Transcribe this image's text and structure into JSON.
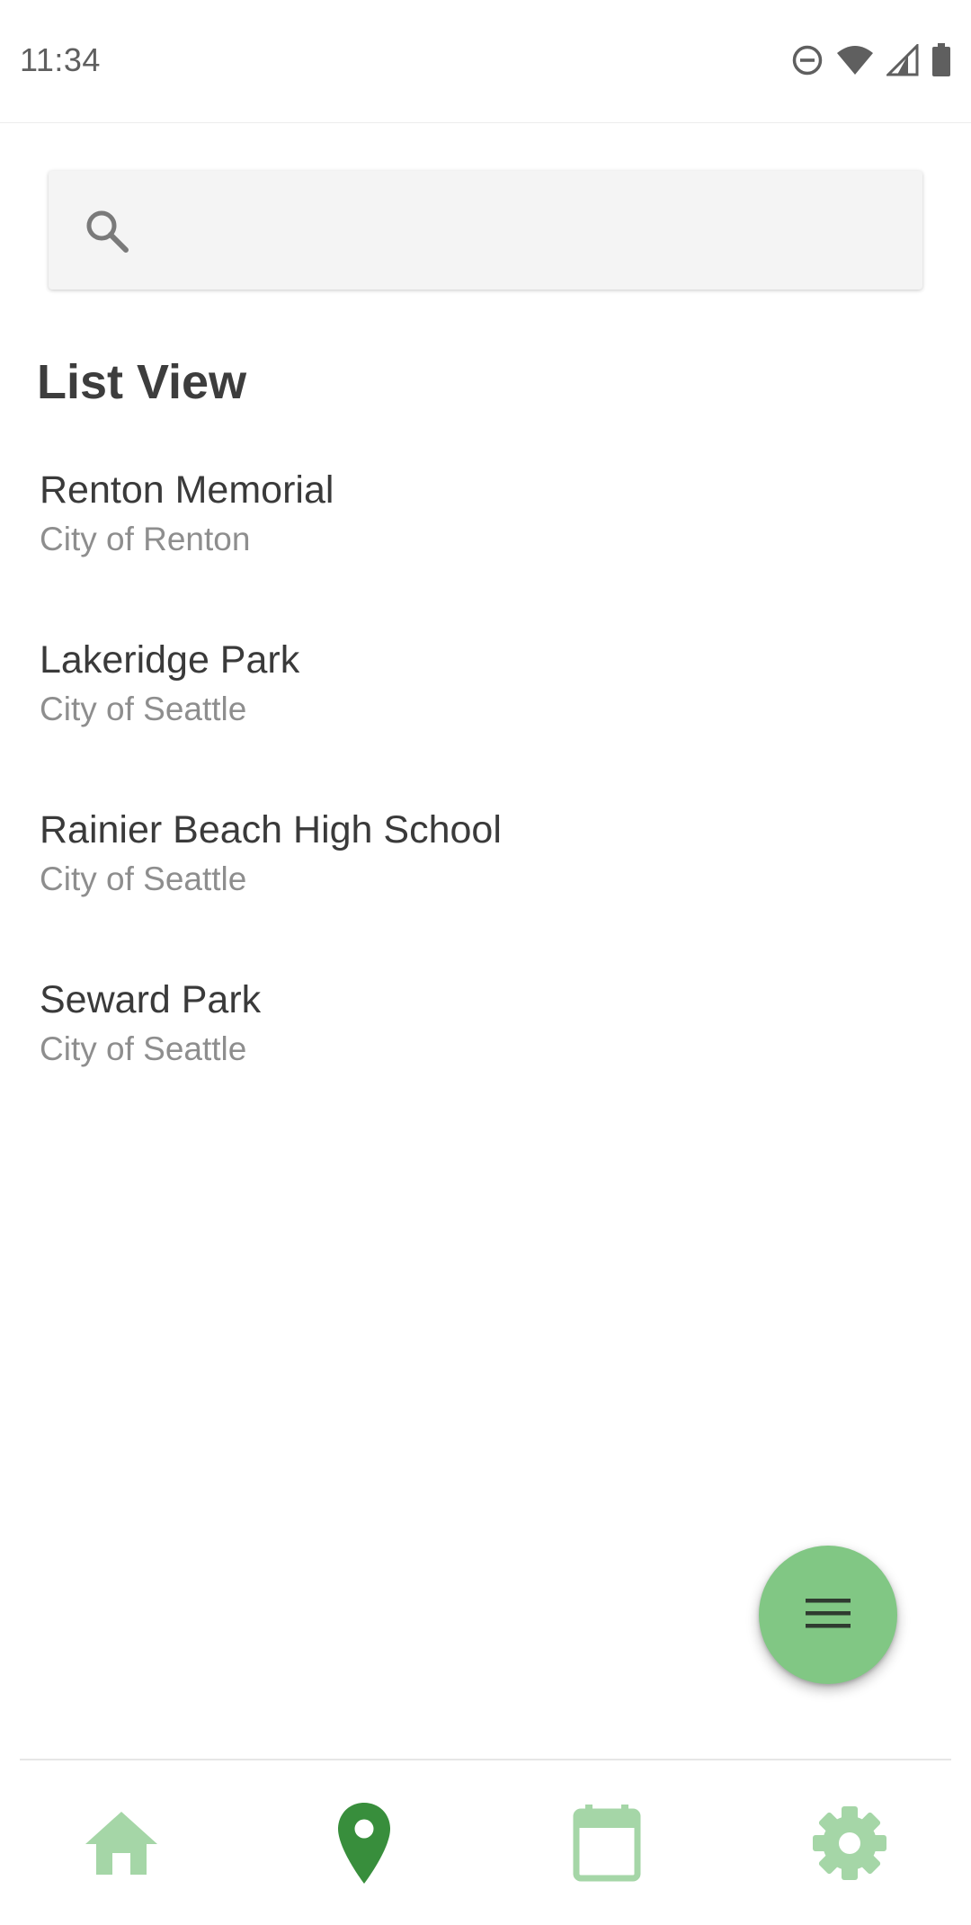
{
  "status_bar": {
    "time": "11:34",
    "icons": [
      "do-not-disturb-icon",
      "wifi-icon",
      "signal-icon",
      "battery-icon"
    ]
  },
  "search": {
    "placeholder": "",
    "value": "",
    "icon": "search-icon"
  },
  "main": {
    "title": "List View",
    "items": [
      {
        "name": "Renton Memorial",
        "subtitle": "City of Renton"
      },
      {
        "name": "Lakeridge Park",
        "subtitle": "City of Seattle"
      },
      {
        "name": "Rainier Beach High School",
        "subtitle": "City of Seattle"
      },
      {
        "name": "Seward Park",
        "subtitle": "City of Seattle"
      }
    ]
  },
  "fab": {
    "icon": "menu-icon",
    "color": "#81c784"
  },
  "bottom_nav": {
    "items": [
      {
        "icon": "home-icon",
        "active": false
      },
      {
        "icon": "map-pin-icon",
        "active": true
      },
      {
        "icon": "calendar-icon",
        "active": false
      },
      {
        "icon": "settings-gear-icon",
        "active": false
      }
    ],
    "active_color": "#388e3c",
    "inactive_color": "#a5d6a7"
  }
}
